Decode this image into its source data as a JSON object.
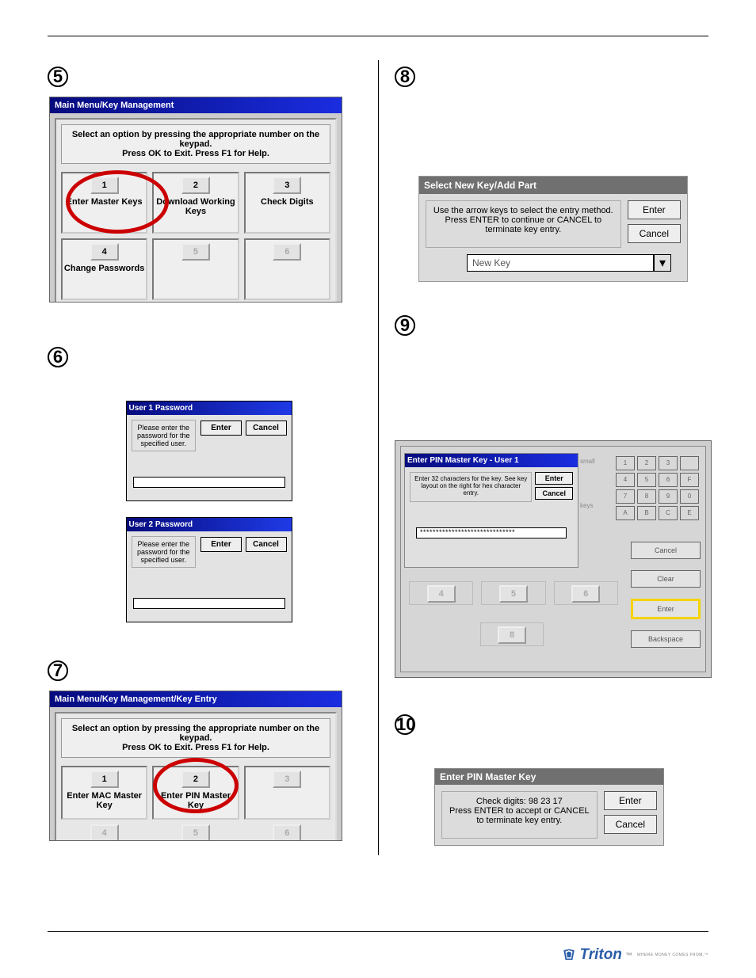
{
  "step5": {
    "num": "5",
    "title": "Main Menu/Key Management",
    "instructions_l1": "Select an option by pressing the appropriate number on the keypad.",
    "instructions_l2": "Press OK to Exit.  Press F1 for Help.",
    "buttons": {
      "b1": "1",
      "l1": "Enter Master Keys",
      "b2": "2",
      "l2": "Download Working Keys",
      "b3": "3",
      "l3": "Check Digits",
      "b4": "4",
      "l4": "Change Passwords",
      "b5": "5",
      "l5": "",
      "b6": "6",
      "l6": ""
    }
  },
  "step6": {
    "num": "6",
    "dlg1": {
      "title": "User 1 Password",
      "msg": "Please enter the password for the specified user.",
      "enter": "Enter",
      "cancel": "Cancel"
    },
    "dlg2": {
      "title": "User 2 Password",
      "msg": "Please enter the password for the specified user.",
      "enter": "Enter",
      "cancel": "Cancel"
    }
  },
  "step7": {
    "num": "7",
    "title": "Main Menu/Key Management/Key Entry",
    "instructions_l1": "Select an option by pressing the appropriate number on the keypad.",
    "instructions_l2": "Press OK to Exit.  Press F1 for Help.",
    "buttons": {
      "b1": "1",
      "l1": "Enter MAC Master Key",
      "b2": "2",
      "l2": "Enter PIN Master Key",
      "b3": "3",
      "l3": "",
      "b4": "4",
      "b5": "5",
      "b6": "6"
    }
  },
  "step8": {
    "num": "8",
    "title": "Select New Key/Add Part",
    "msg": "Use the arrow keys to select the entry method. Press ENTER to continue or CANCEL to terminate key entry.",
    "enter": "Enter",
    "cancel": "Cancel",
    "combo": "New Key"
  },
  "step9": {
    "num": "9",
    "dlg_title": "Enter PIN Master Key - User 1",
    "dlg_msg": "Enter 32 characters for the key. See key layout on the right for hex character entry.",
    "enter": "Enter",
    "cancel": "Cancel",
    "dotline": "******************************",
    "keypad": [
      "1",
      "2",
      "3",
      "",
      "4",
      "5",
      "6",
      "F",
      "7",
      "8",
      "9",
      "0",
      "A",
      "B",
      "C",
      "E"
    ],
    "side": {
      "cancel": "Cancel",
      "clear": "Clear",
      "enter": "Enter",
      "backspace": "Backspace"
    },
    "tags": {
      "small": "small",
      "keys": "keys"
    }
  },
  "step10": {
    "num": "10",
    "title": "Enter PIN  Master Key",
    "msg_l1": "Check digits: 98 23 17",
    "msg_l2": "Press ENTER to accept or CANCEL to terminate key entry.",
    "enter": "Enter",
    "cancel": "Cancel"
  },
  "footer": {
    "brand": "Triton",
    "tag": "WHERE MONEY COMES FROM.™"
  }
}
